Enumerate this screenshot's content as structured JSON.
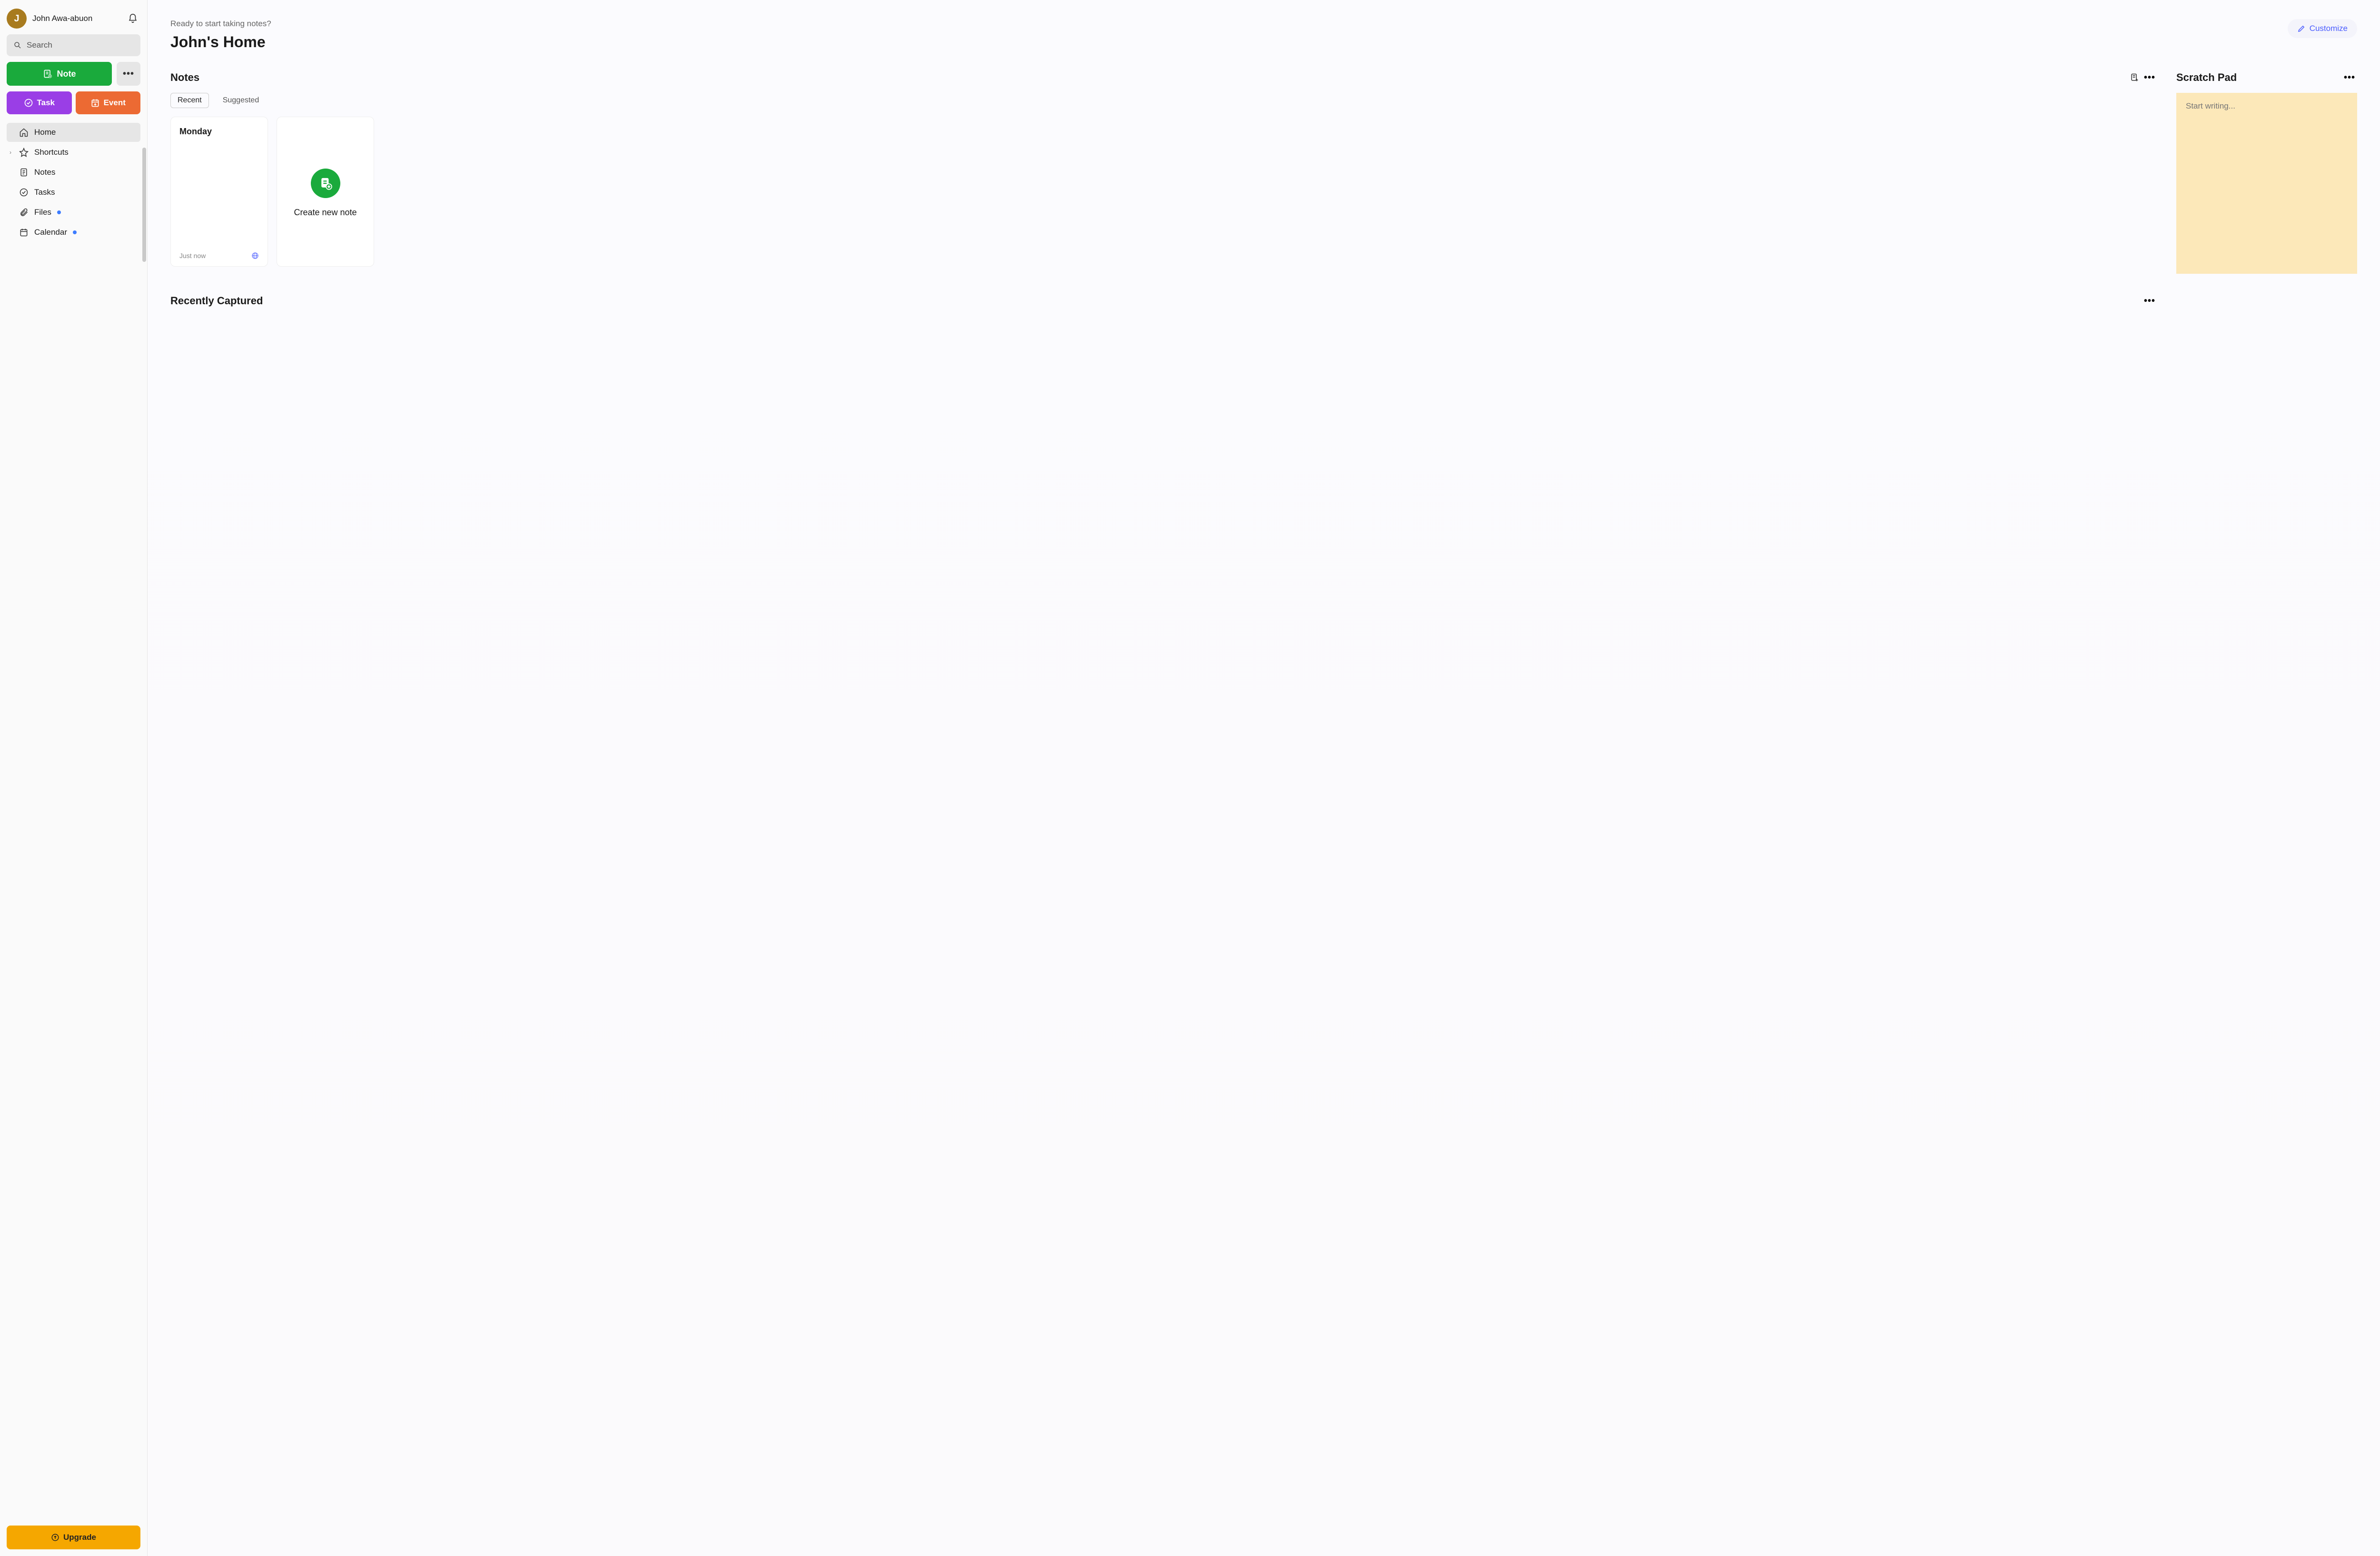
{
  "user": {
    "name": "John Awa-abuon",
    "initial": "J"
  },
  "sidebar": {
    "search_placeholder": "Search",
    "note_btn": "Note",
    "task_btn": "Task",
    "event_btn": "Event",
    "upgrade_btn": "Upgrade",
    "nav": {
      "home": "Home",
      "shortcuts": "Shortcuts",
      "notes": "Notes",
      "tasks": "Tasks",
      "files": "Files",
      "calendar": "Calendar"
    }
  },
  "header": {
    "subtitle": "Ready to start taking notes?",
    "title": "John's Home",
    "customize": "Customize"
  },
  "notes_section": {
    "title": "Notes",
    "tab_recent": "Recent",
    "tab_suggested": "Suggested",
    "card": {
      "title": "Monday",
      "timestamp": "Just now"
    },
    "create_label": "Create new note"
  },
  "recently_section": {
    "title": "Recently Captured"
  },
  "scratch": {
    "title": "Scratch Pad",
    "placeholder": "Start writing..."
  }
}
